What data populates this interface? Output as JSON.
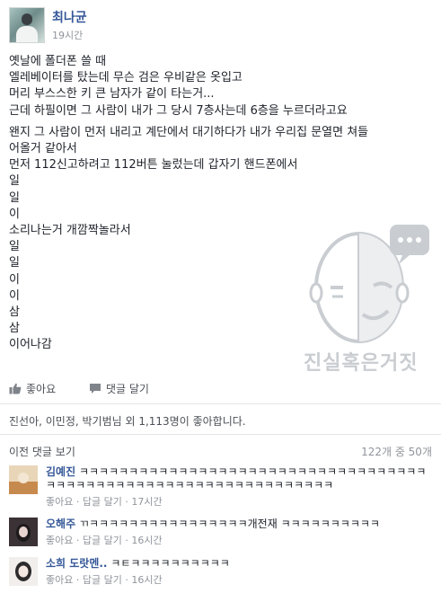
{
  "post": {
    "author": "최나균",
    "time": "19시간",
    "paragraphs": [
      [
        "옛날에 폴더폰 쓸 때",
        "엘레베이터를 탔는데 무슨 검은 우비같은 옷입고",
        "머리 부스스한 키 큰 남자가 같이 타는거...",
        "근데 하필이면 그 사람이 내가 그 당시 7층사는데 6층을 누르더라고요"
      ],
      [
        "왠지 그 사람이 먼저 내리고 계단에서 대기하다가 내가 우리집 문열면 쳐들",
        "어올거 같아서",
        "먼저 112신고하려고 112버튼 눌렀는데 갑자기 핸드폰에서",
        "일",
        "일",
        "이",
        "소리나는거 개깜짝놀라서",
        "일",
        "일",
        "이",
        "이",
        "삼",
        "삼",
        "이어나감"
      ]
    ]
  },
  "watermark": {
    "text": "진실혹은거짓"
  },
  "actions": {
    "like": "좋아요",
    "comment": "댓글 달기"
  },
  "likes_summary": "진선아, 이민정, 박기범님 외 1,113명이 좋아합니다.",
  "comments_header": {
    "prev_label": "이전 댓글 보기",
    "count": "122개 중 50개"
  },
  "comments": [
    {
      "name": "김예진",
      "text": "ㅋㅋㅋㅋㅋㅋㅋㅋㅋㅋㅋㅋㅋㅋㅋㅋㅋㅋㅋㅋㅋㅋㅋㅋㅋㅋㅋㅋㅋㅋㅋㅋㅋㅋㅋㅋㅋㅋㅋㅋㅋㅋㅋㅋㅋㅋㅋㅋㅋㅋㅋㅋㅋㅋㅋㅋㅋㅋㅋㅋㅋㅋㅋㅋ",
      "like": "좋아요",
      "reply": "답글 달기",
      "time": "17시간"
    },
    {
      "name": "오해주",
      "text": "ㄲㅋㅋㅋㅋㅋㅋㅋㅋㅋㅋㅋㅋㅋㅋㅋㅋ개전재 ㅋㅋㅋㅋㅋㅋㅋㅋㅋㅋ",
      "like": "좋아요",
      "reply": "답글 달기",
      "time": "16시간"
    },
    {
      "name": "소희 도랏멘..",
      "text": "ㅋㅌㅋㅋㅋㅋㅋㅋㅋㅋㅋㅋ",
      "like": "좋아요",
      "reply": "답글 달기",
      "time": "16시간"
    }
  ],
  "colors": {
    "link": "#365899",
    "meta": "#90949c",
    "text": "#1d2129",
    "divider": "#e5e5e5"
  },
  "icons": {
    "like": "thumbs-up-icon",
    "comment": "speech-bubble-icon"
  }
}
